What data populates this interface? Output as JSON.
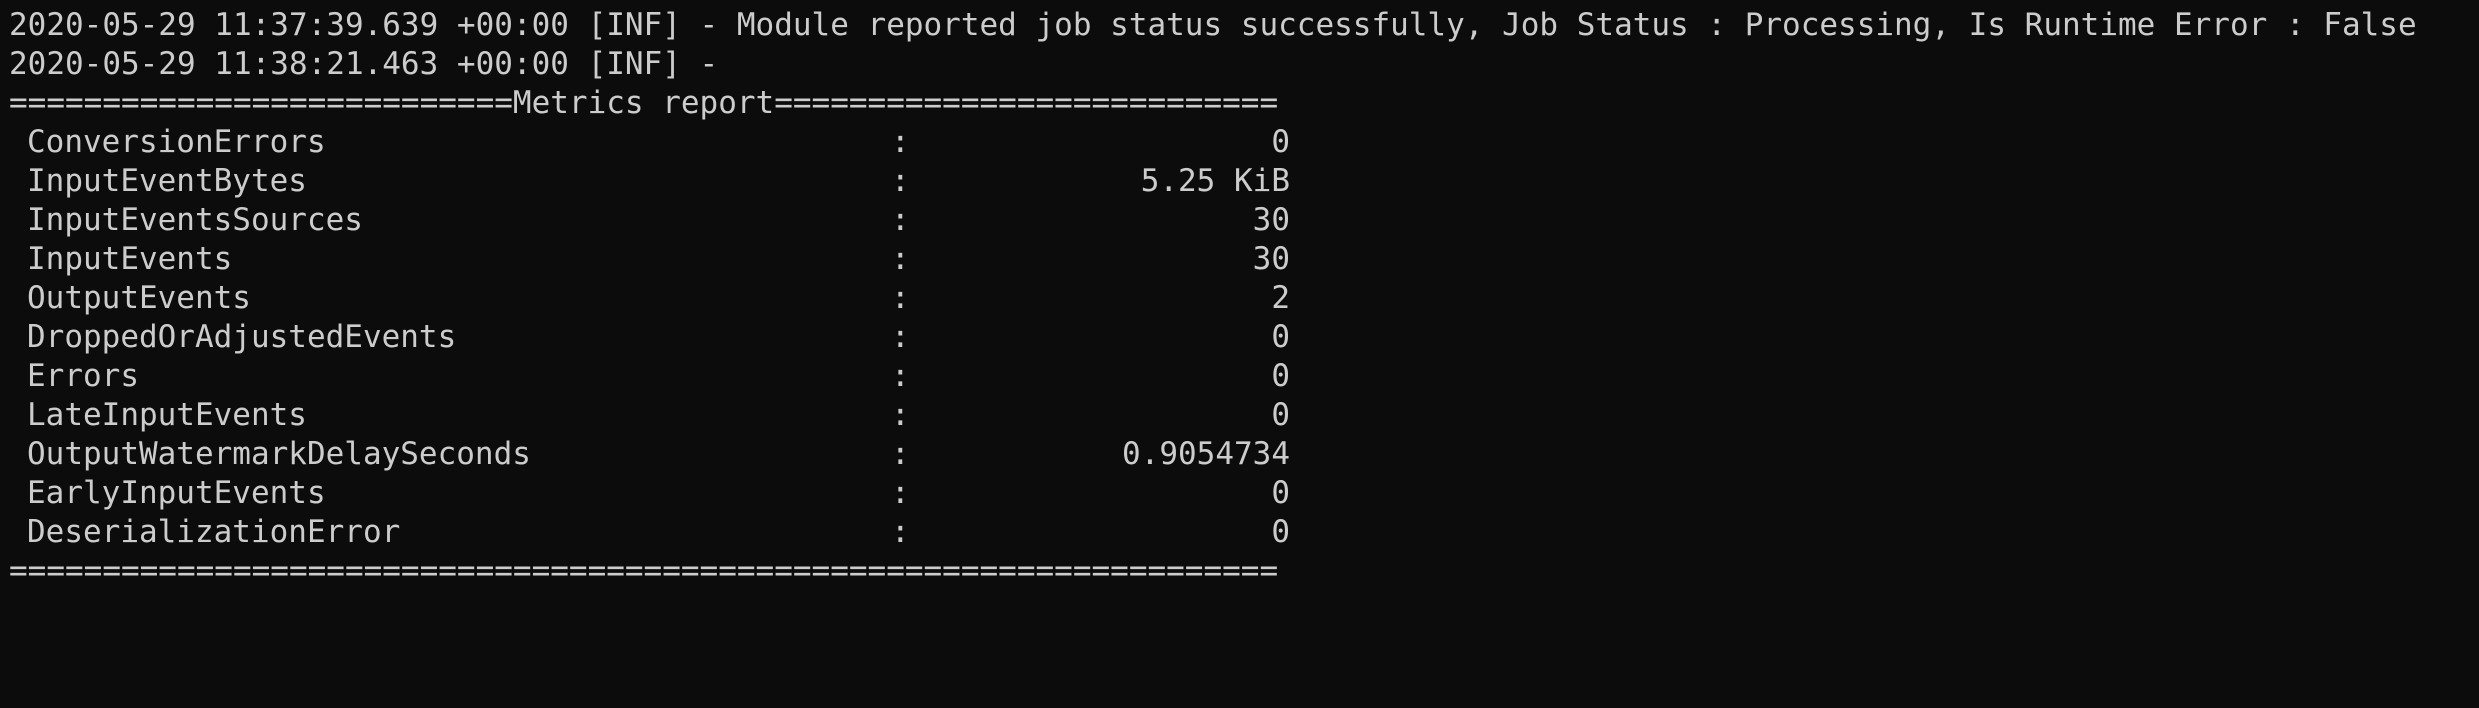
{
  "log_lines": [
    "2020-05-29 11:37:39.639 +00:00 [INF] - Module reported job status successfully, Job Status : Processing, Is Runtime Error : False",
    "2020-05-29 11:38:21.463 +00:00 [INF] -"
  ],
  "report_header": "===========================Metrics report===========================",
  "metrics_separator": ":",
  "metrics": [
    {
      "name": "ConversionErrors",
      "value": "0"
    },
    {
      "name": "InputEventBytes",
      "value": "5.25 KiB"
    },
    {
      "name": "InputEventsSources",
      "value": "30"
    },
    {
      "name": "InputEvents",
      "value": "30"
    },
    {
      "name": "OutputEvents",
      "value": "2"
    },
    {
      "name": "DroppedOrAdjustedEvents",
      "value": "0"
    },
    {
      "name": "Errors",
      "value": "0"
    },
    {
      "name": "LateInputEvents",
      "value": "0"
    },
    {
      "name": "OutputWatermarkDelaySeconds",
      "value": "0.9054734"
    },
    {
      "name": "EarlyInputEvents",
      "value": "0"
    },
    {
      "name": "DeserializationError",
      "value": "0"
    }
  ],
  "report_footer": "====================================================================",
  "colors": {
    "background": "#0c0c0c",
    "text": "#cccccc"
  }
}
